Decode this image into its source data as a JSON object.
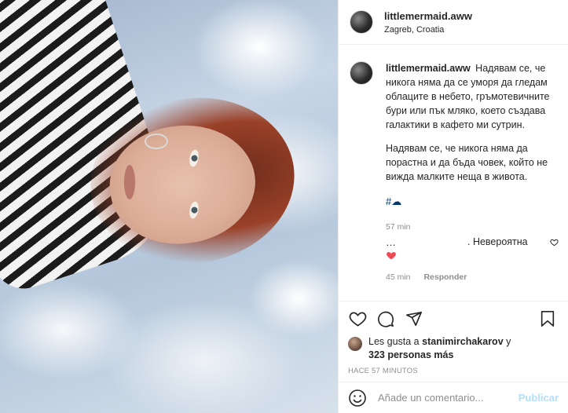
{
  "post": {
    "username": "littlemermaid.aww",
    "location": "Zagreb, Croatia",
    "caption": {
      "username": "littlemermaid.aww",
      "paragraph1": "Надявам се, че никога няма да се уморя да гледам облаците в небето, гръмотевичните бури или пък мляко, което създава галактики в кафето ми сутрин.",
      "paragraph2": "Надявам се, че никога няма да порастна и да бъда човек, който не вижда малките неща в живота.",
      "hashtag": "#☁",
      "time": "57 min"
    },
    "reply": {
      "prefix": "…",
      "text": ". Невероятна",
      "time": "45 min",
      "reply_label": "Responder"
    },
    "likes": {
      "prefix": "Les gusta a",
      "liker": "stanimirchakarov",
      "connector": "y",
      "count": "323 personas más"
    },
    "posted_ago": "HACE 57 MINUTOS",
    "comment_box": {
      "placeholder": "Añade un comentario...",
      "publish_label": "Publicar"
    }
  },
  "icons": {
    "like": "heart-outline-icon",
    "comment": "speech-bubble-icon",
    "share": "paper-plane-icon",
    "save": "bookmark-icon",
    "emoji": "smiley-icon",
    "comment_like": "small-heart-icon",
    "liked_indicator": "red-heart-icon"
  },
  "colors": {
    "like_red": "#ed4956",
    "link_blue": "#00376b",
    "muted_gray": "#8e8e8e",
    "publish_disabled": "#b2dffc"
  }
}
